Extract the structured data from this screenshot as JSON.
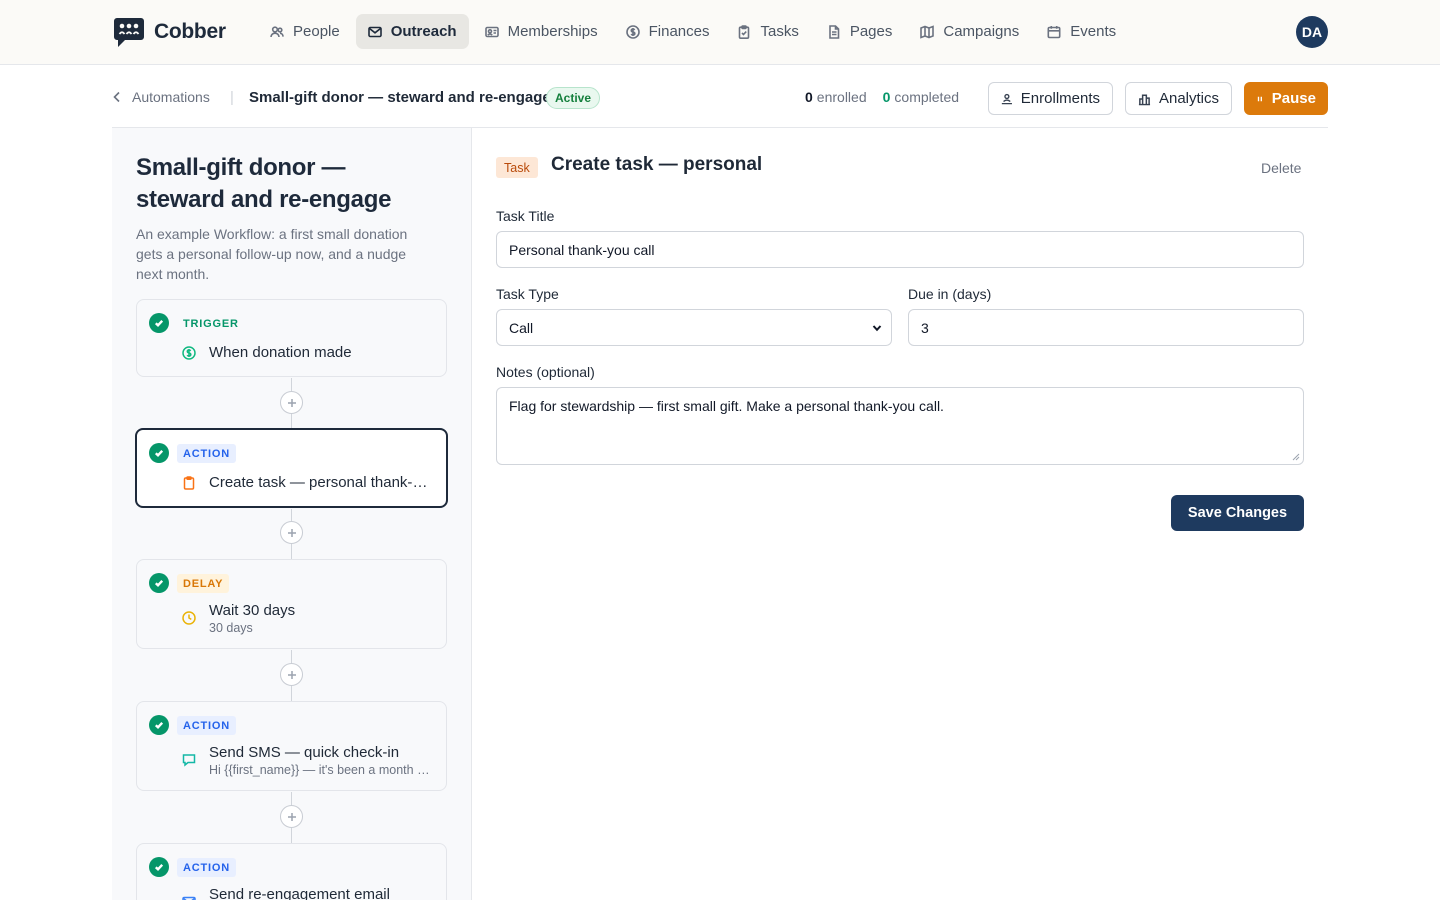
{
  "brand": {
    "name": "Cobber",
    "accent": "#1e3a5f",
    "pause_color": "#dc7a0b",
    "success": "#059669"
  },
  "nav": {
    "items": [
      {
        "label": "People",
        "icon": "people-icon",
        "active": false
      },
      {
        "label": "Outreach",
        "icon": "mail-icon",
        "active": true
      },
      {
        "label": "Memberships",
        "icon": "id-card-icon",
        "active": false
      },
      {
        "label": "Finances",
        "icon": "dollar-icon",
        "active": false
      },
      {
        "label": "Tasks",
        "icon": "clipboard-icon",
        "active": false
      },
      {
        "label": "Pages",
        "icon": "document-icon",
        "active": false
      },
      {
        "label": "Campaigns",
        "icon": "map-icon",
        "active": false
      },
      {
        "label": "Events",
        "icon": "calendar-icon",
        "active": false
      }
    ],
    "avatar_initials": "DA"
  },
  "subheader": {
    "back_label": "Automations",
    "separator": "|",
    "title": "Small-gift donor — steward and re-engage",
    "status": "Active",
    "enrolled_count": "0",
    "enrolled_label": "enrolled",
    "completed_count": "0",
    "completed_label": "completed",
    "enrollments_label": "Enrollments",
    "analytics_label": "Analytics",
    "pause_label": "Pause"
  },
  "workflow": {
    "title": "Small-gift donor — steward and re-engage",
    "description": "An example Workflow: a first small donation gets a personal follow-up now, and a nudge next month.",
    "steps": [
      {
        "kind": "TRIGGER",
        "icon": "dollar-circle-icon",
        "title": "When donation made",
        "subtitle": ""
      },
      {
        "kind": "ACTION",
        "icon": "clipboard-icon",
        "title": "Create task — personal thank-you call",
        "subtitle": "",
        "selected": true
      },
      {
        "kind": "DELAY",
        "icon": "clock-icon",
        "title": "Wait 30 days",
        "subtitle": "30 days"
      },
      {
        "kind": "ACTION",
        "icon": "chat-icon",
        "title": "Send SMS — quick check-in",
        "subtitle": "Hi {{first_name}} — it's been a month since your gift"
      },
      {
        "kind": "ACTION",
        "icon": "mail-icon",
        "title": "Send re-engagement email",
        "subtitle": ""
      }
    ]
  },
  "editor": {
    "tag": "Task",
    "title": "Create task — personal thank-you call",
    "delete_label": "Delete",
    "task_title_label": "Task Title",
    "task_title_value": "Personal thank-you call",
    "task_type_label": "Task Type",
    "task_type_value": "Call",
    "due_label": "Due in (days)",
    "due_value": "3",
    "notes_label": "Notes (optional)",
    "notes_value": "Flag for stewardship — first small gift. Make a personal thank-you call.",
    "save_label": "Save Changes"
  }
}
